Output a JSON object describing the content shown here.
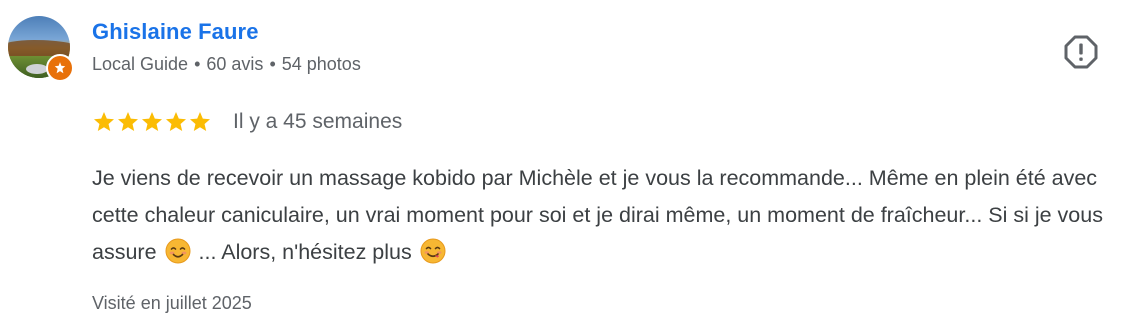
{
  "review": {
    "author": {
      "name": "Ghislaine Faure",
      "badge": "Local Guide",
      "reviews_count": "60 avis",
      "photos_count": "54 photos",
      "separator": "•"
    },
    "rating": 5,
    "rating_max": 5,
    "date": "Il y a 45 semaines",
    "text_part1": "Je viens de recevoir un massage kobido par Michèle et je vous la recommande... Même en plein été avec cette chaleur caniculaire, un vrai moment pour soi et je dirai même, un moment de fraîcheur... Si si je vous assure",
    "text_part2": "... Alors, n'hésitez plus",
    "visited": "Visité en juillet 2025"
  },
  "icons": {
    "report": "report-flag-icon",
    "star": "star-icon",
    "emoji_1": "smiling-face-with-smiling-eyes-emoji",
    "emoji_2": "face-savoring-food-emoji",
    "guide": "local-guide-star-icon"
  },
  "colors": {
    "author_name": "#1a73e8",
    "star": "#fbbc04",
    "badge": "#e8710a",
    "text": "#3c4043",
    "meta": "#5f6368"
  }
}
